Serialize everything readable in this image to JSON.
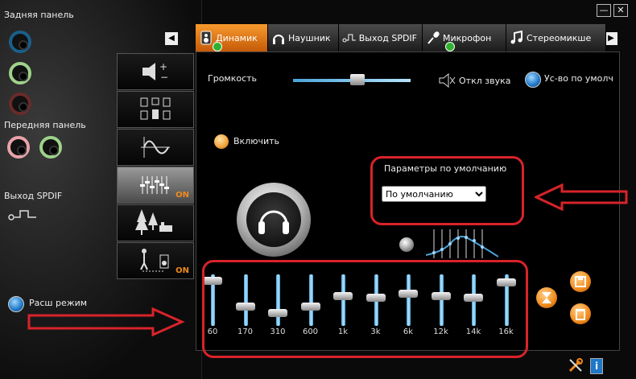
{
  "left": {
    "rear_panel_label": "Задняя панель",
    "front_panel_label": "Передняя панель",
    "spdif_out_label": "Выход SPDIF",
    "advanced_mode_label": "Расш режим"
  },
  "tabs": [
    {
      "label": "Динамик",
      "active": true
    },
    {
      "label": "Наушник",
      "active": false
    },
    {
      "label": "Выход SPDIF",
      "active": false
    },
    {
      "label": "Микрофон",
      "active": false
    },
    {
      "label": "Стереомикше",
      "active": false
    }
  ],
  "nav": {
    "prev": "◀",
    "next": "▶"
  },
  "window": {
    "minimize": "—",
    "close": "✕"
  },
  "icon_column": [
    {
      "icon": "speaker-volume-icon",
      "on": ""
    },
    {
      "icon": "speaker-config-icon",
      "on": ""
    },
    {
      "icon": "sine-wave-icon",
      "on": ""
    },
    {
      "icon": "equalizer-icon",
      "on": "ON"
    },
    {
      "icon": "environment-forest-icon",
      "on": ""
    },
    {
      "icon": "room-correction-icon",
      "on": "ON"
    }
  ],
  "main": {
    "volume_label": "Громкость",
    "volume_level": 0.55,
    "mute_label": "Откл звука",
    "default_device_label": "Ус-во по умолч",
    "enable_label": "Включить",
    "preset_title": "Параметры по умолчанию",
    "preset_value": "По умолчанию",
    "preset_options": [
      "По умолчанию"
    ]
  },
  "equalizer": {
    "bands": [
      {
        "freq": "60",
        "level": 0.95
      },
      {
        "freq": "170",
        "level": 0.35
      },
      {
        "freq": "310",
        "level": 0.2
      },
      {
        "freq": "600",
        "level": 0.35
      },
      {
        "freq": "1k",
        "level": 0.6
      },
      {
        "freq": "3k",
        "level": 0.55
      },
      {
        "freq": "6k",
        "level": 0.65
      },
      {
        "freq": "12k",
        "level": 0.6
      },
      {
        "freq": "14k",
        "level": 0.55
      },
      {
        "freq": "16k",
        "level": 0.9
      }
    ]
  },
  "colors": {
    "accent": "#f08a1a",
    "highlight_red": "#d8232a",
    "track_blue": "#4aa3d8"
  }
}
